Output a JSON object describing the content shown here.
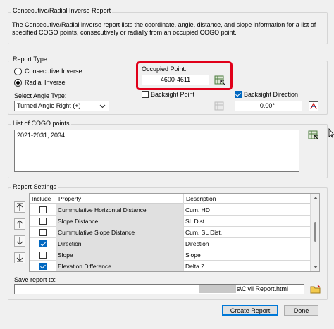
{
  "description_group": {
    "title": "Consecutive/Radial Inverse Report",
    "text": "The Consecutive/Radial inverse report lists the coordinate, angle, distance, and slope information for a list of specified COGO points, consecutively or radially from an occupied COGO point."
  },
  "report_type": {
    "title": "Report Type",
    "consecutive_label": "Consecutive Inverse",
    "radial_label": "Radial Inverse",
    "selected": "radial",
    "angle_type_label": "Select Angle Type:",
    "angle_type_value": "Turned Angle Right (+)",
    "occupied_point_label": "Occupied Point:",
    "occupied_point_value": "4600-4611",
    "backsight_point_label": "Backsight Point",
    "backsight_point_checked": false,
    "backsight_direction_label": "Backsight Direction",
    "backsight_direction_checked": true,
    "backsight_direction_value": "0.00°"
  },
  "cogo_points": {
    "title": "List of COGO points",
    "value": "2021-2031, 2034"
  },
  "report_settings": {
    "title": "Report Settings",
    "columns": [
      "Include",
      "Property",
      "Description"
    ],
    "rows": [
      {
        "include": false,
        "property": "Cummulative Horizontal Distance",
        "description": "Cum. HD"
      },
      {
        "include": false,
        "property": "Slope Distance",
        "description": "SL Dist."
      },
      {
        "include": false,
        "property": "Cummulative Slope Distance",
        "description": "Cum. SL Dist."
      },
      {
        "include": true,
        "property": "Direction",
        "description": "Direction"
      },
      {
        "include": false,
        "property": "Slope",
        "description": "Slope"
      },
      {
        "include": true,
        "property": "Elevation Difference",
        "description": "Delta Z"
      }
    ]
  },
  "save": {
    "label": "Save report to:",
    "path_visible": "s\\Civil Report.html"
  },
  "buttons": {
    "create_report": "Create Report",
    "done": "Done"
  },
  "colors": {
    "highlight": "#e0001a",
    "accent": "#0067c0"
  }
}
